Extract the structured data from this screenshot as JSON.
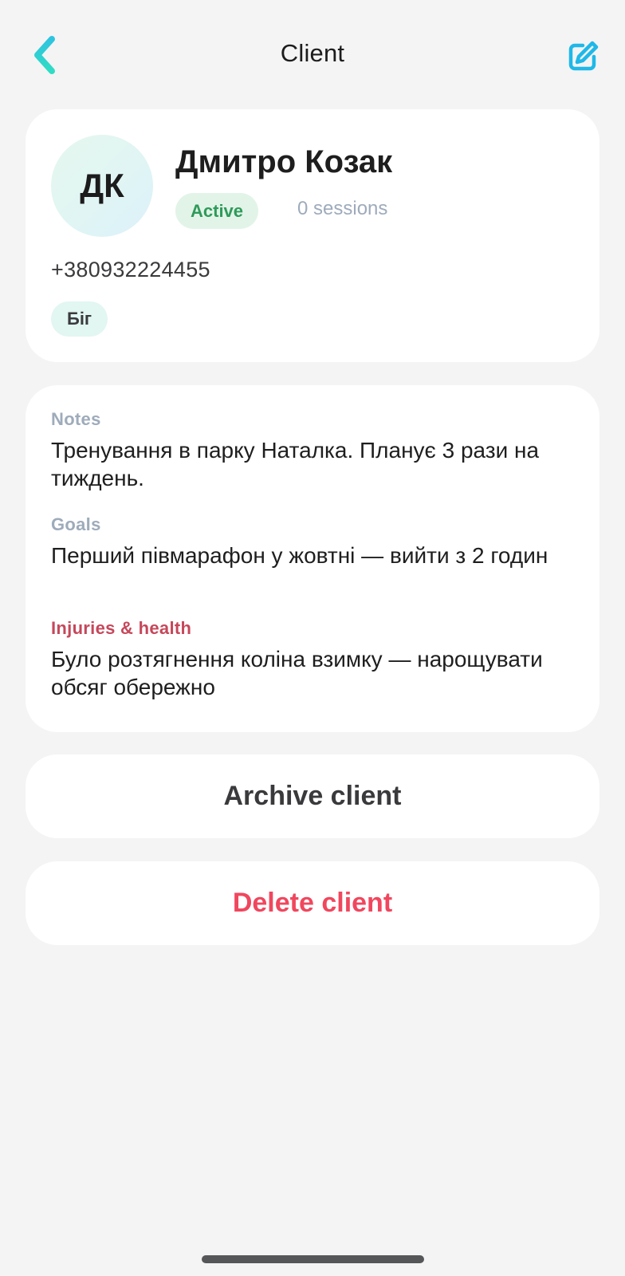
{
  "header": {
    "title": "Client",
    "back_icon": "chevron-left-icon",
    "edit_icon": "edit-icon",
    "accent_color": "#2ad4d8"
  },
  "profile": {
    "initials": "ДК",
    "name": "Дмитро Козак",
    "status": "Active",
    "sessions": "0 sessions",
    "phone": "+380932224455",
    "tags": [
      "Біг"
    ]
  },
  "details": {
    "notes": {
      "label": "Notes",
      "text": "Тренування в парку Наталка. Планує 3 рази на тиждень."
    },
    "goals": {
      "label": "Goals",
      "text": "Перший півмарафон у жовтні — вийти з 2 годин"
    },
    "injuries": {
      "label": "Injuries & health",
      "text": "Було розтягнення коліна взимку — нарощувати обсяг обережно"
    }
  },
  "actions": {
    "archive_label": "Archive client",
    "delete_label": "Delete client"
  },
  "colors": {
    "status_active": "#2e9a5a",
    "danger": "#f0475e",
    "muted": "#9eabbb"
  }
}
